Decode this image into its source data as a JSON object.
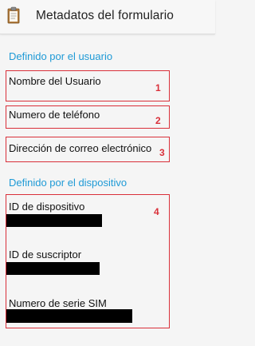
{
  "appbar": {
    "title": "Metadatos del formulario",
    "icon": "clipboard-icon"
  },
  "sections": {
    "user": {
      "header": "Definido por el usuario",
      "fields": [
        {
          "label": "Nombre del Usuario",
          "annotation": "1"
        },
        {
          "label": "Numero de teléfono",
          "annotation": "2"
        },
        {
          "label": "Dirección de correo electrónico",
          "annotation": "3"
        }
      ]
    },
    "device": {
      "header": "Definido por el dispositivo",
      "annotation": "4",
      "fields": [
        {
          "label": "ID de dispositivo"
        },
        {
          "label": "ID de suscriptor"
        },
        {
          "label": "Numero de serie SIM"
        }
      ]
    }
  },
  "colors": {
    "accent": "#1e9ad6",
    "annotation": "#d9303a",
    "redaction": "#000000"
  }
}
